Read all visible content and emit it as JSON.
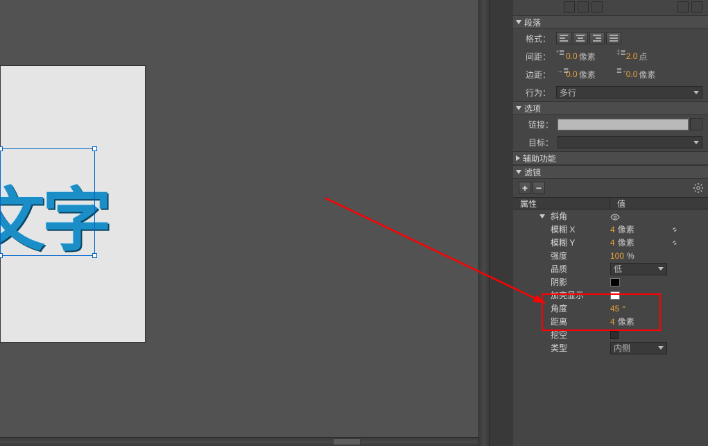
{
  "canvas_text": "文字",
  "sections": {
    "paragraph": "段落",
    "options": "选项",
    "accessibility": "辅助功能",
    "filters": "滤镜"
  },
  "labels": {
    "format": "格式：",
    "spacing": "间距：",
    "margin": "边距：",
    "behavior": "行为：",
    "link": "链接：",
    "target": "目标："
  },
  "spacing": {
    "indent": {
      "val": "0.0",
      "unit": "像素"
    },
    "leading": {
      "val": "2.0",
      "unit": "点"
    }
  },
  "margin": {
    "left": {
      "val": "0.0",
      "unit": "像素"
    },
    "right": {
      "val": "0.0",
      "unit": "像素"
    }
  },
  "behavior_value": "多行",
  "table": {
    "col1": "属性",
    "col2": "值"
  },
  "filter_name": "斜角",
  "props": {
    "blurx": {
      "name": "模糊 X",
      "val": "4",
      "unit": "像素"
    },
    "blury": {
      "name": "模糊 Y",
      "val": "4",
      "unit": "像素"
    },
    "strength": {
      "name": "强度",
      "val": "100",
      "unit": "%"
    },
    "quality": {
      "name": "品质",
      "val": "低"
    },
    "shadow": {
      "name": "阴影"
    },
    "highlight": {
      "name": "加亮显示"
    },
    "angle": {
      "name": "角度",
      "val": "45",
      "unit": "°"
    },
    "distance": {
      "name": "距离",
      "val": "4",
      "unit": "像素"
    },
    "knockout": {
      "name": "挖空"
    },
    "type": {
      "name": "类型",
      "val": "内侧"
    }
  }
}
